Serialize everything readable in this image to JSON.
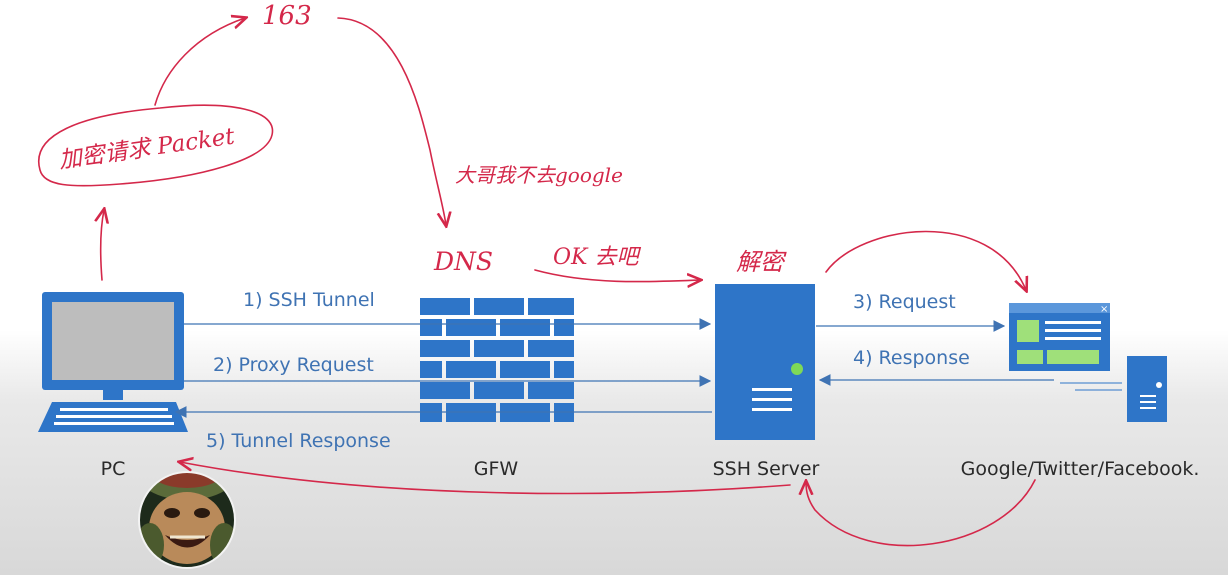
{
  "nodes": {
    "pc": "PC",
    "gfw": "GFW",
    "ssh_server": "SSH Server",
    "destination": "Google/Twitter/Facebook."
  },
  "flows": {
    "ssh_tunnel": "1) SSH Tunnel",
    "proxy_request": "2) Proxy Request",
    "request": "3) Request",
    "response": "4) Response",
    "tunnel_response": "5) Tunnel Response"
  },
  "annotations": {
    "encrypted_packet": "加密请求 Packet",
    "number_163": "163",
    "guard_note": "大哥我不去google",
    "dns": "DNS",
    "ok_go": "OK 去吧",
    "decrypt": "解密"
  },
  "colors": {
    "diagram_blue": "#3f73b3",
    "icon_blue": "#2e75c8",
    "annotation_red": "#d4284a",
    "caption_text": "#2a2a2a"
  }
}
